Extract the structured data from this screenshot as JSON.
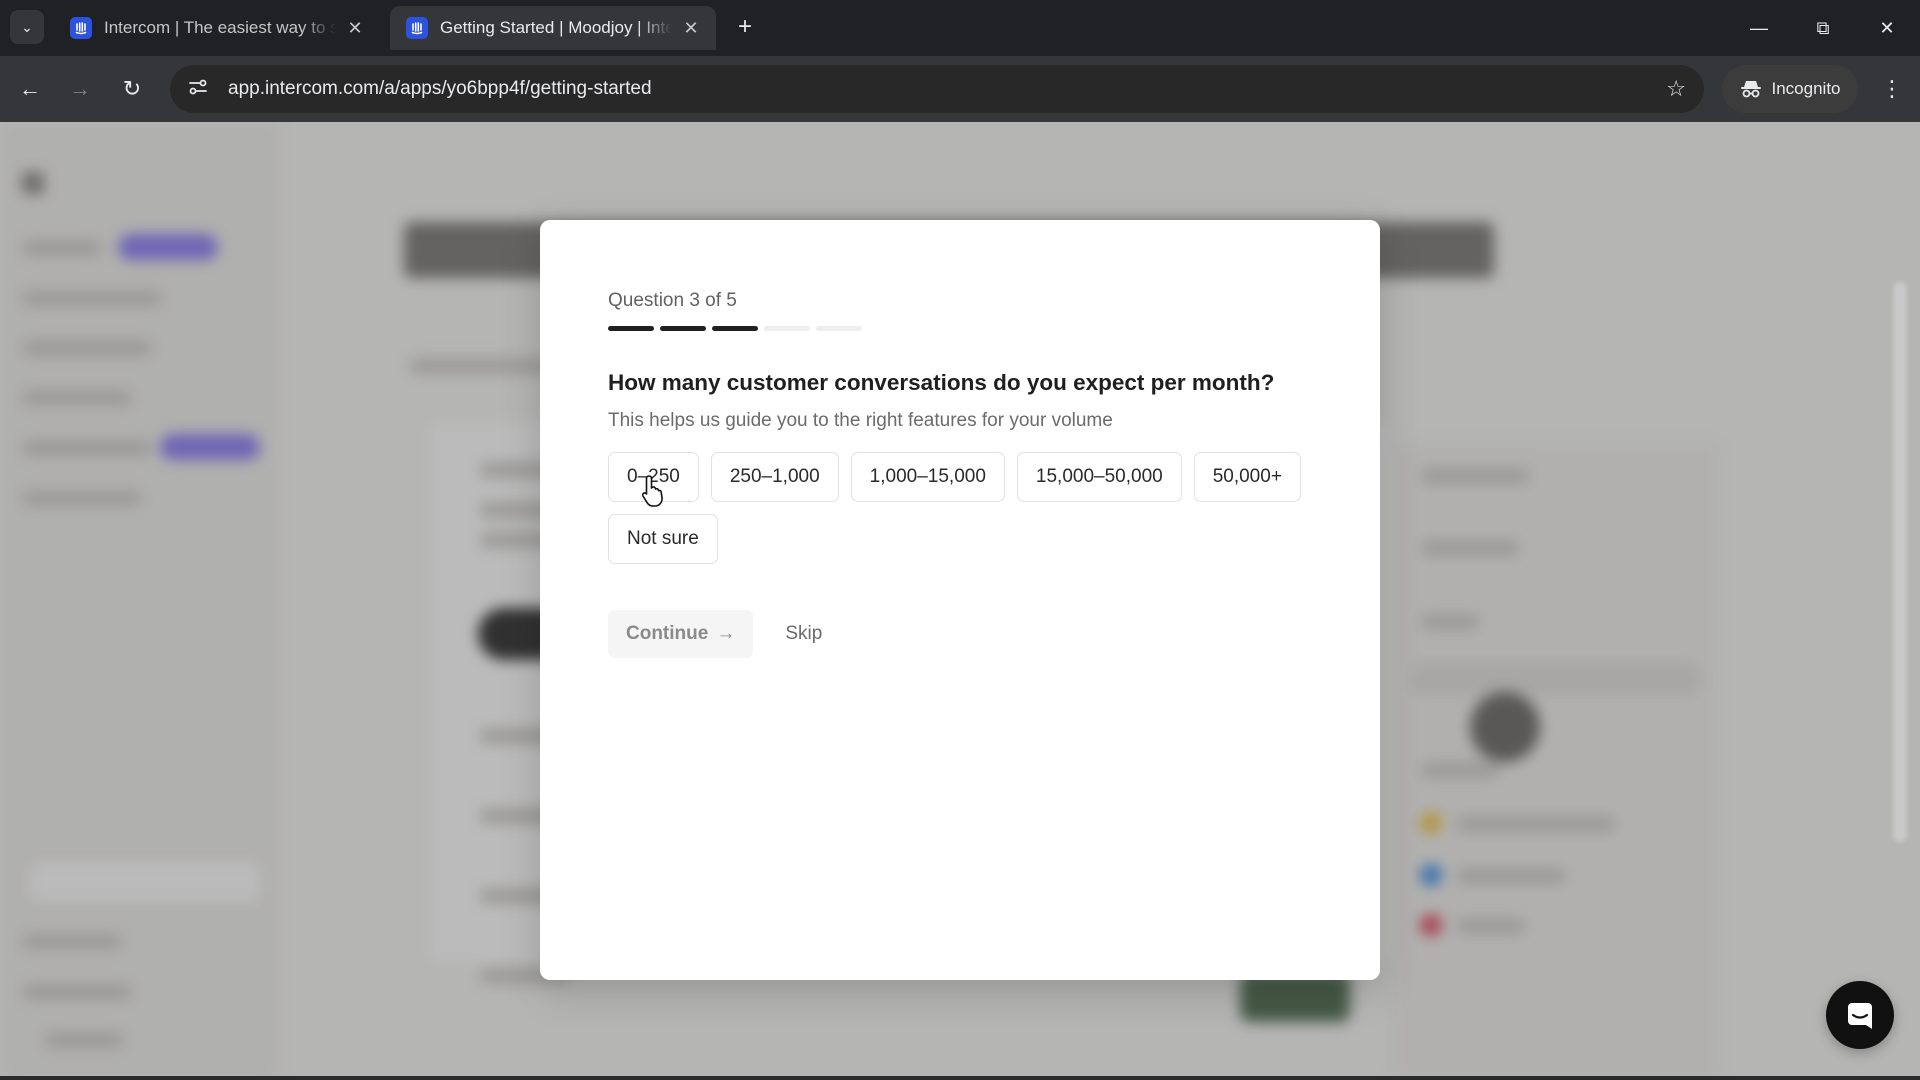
{
  "browser": {
    "tabs": [
      {
        "title": "Intercom | The easiest way to se",
        "active": false
      },
      {
        "title": "Getting Started | Moodjoy | Inte",
        "active": true
      }
    ],
    "url": "app.intercom.com/a/apps/yo6bpp4f/getting-started",
    "incognito_label": "Incognito"
  },
  "modal": {
    "question_counter": "Question 3 of 5",
    "progress": {
      "current": 3,
      "total": 5
    },
    "question": "How many customer conversations do you expect per month?",
    "subtitle": "This helps us guide you to the right features for your volume",
    "options": [
      "0–250",
      "250–1,000",
      "1,000–15,000",
      "15,000–50,000",
      "50,000+",
      "Not sure"
    ],
    "continue_label": "Continue",
    "skip_label": "Skip"
  },
  "colors": {
    "accent_purple": "#8b7cf6",
    "intercom_blue": "#2e52e0",
    "primary_text": "#1f1f1f"
  }
}
